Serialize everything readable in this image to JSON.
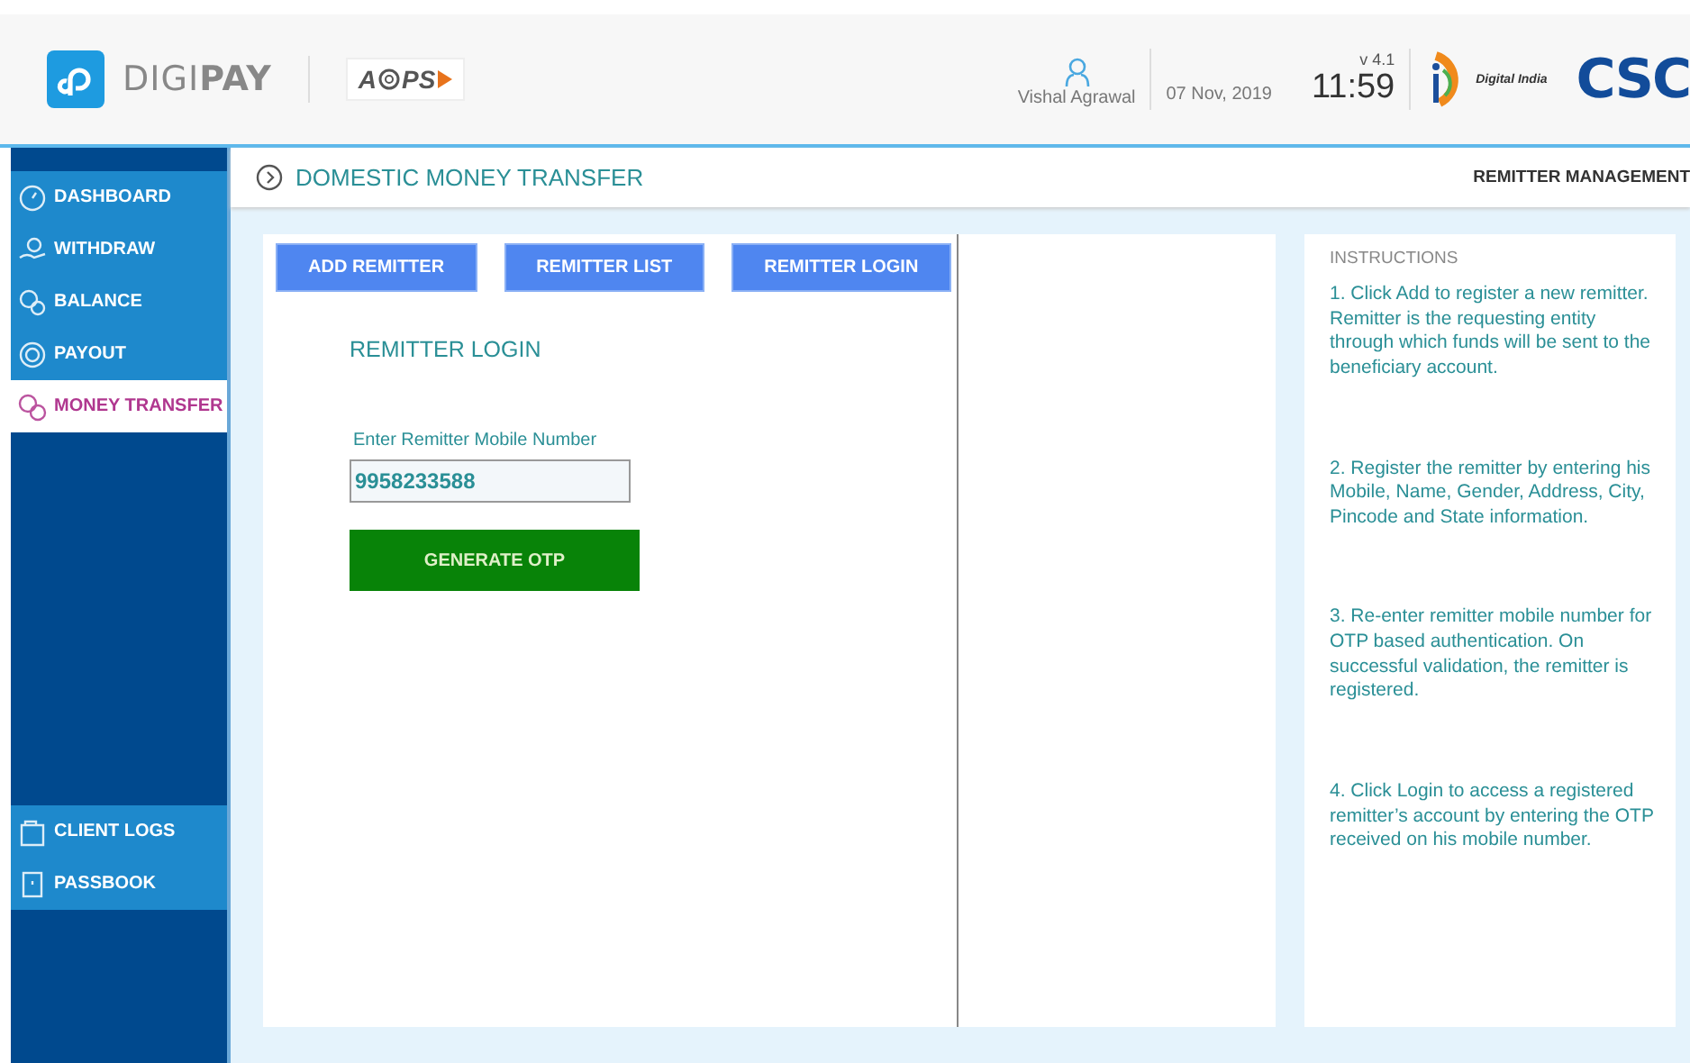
{
  "header": {
    "brand": "DIGI**PAY**",
    "aeps_logo": {
      "left": "A",
      "right": "PS"
    },
    "user_name": "Vishal Agrawal",
    "date": "07 Nov, 2019",
    "version": "v 4.1",
    "time": "11:59",
    "digital_india": "Digital India",
    "csc": "CSC"
  },
  "sidebar": {
    "items": [
      {
        "label": "DASHBOARD",
        "selected": false
      },
      {
        "label": "WITHDRAW",
        "selected": false
      },
      {
        "label": "BALANCE",
        "selected": false
      },
      {
        "label": "PAYOUT",
        "selected": false
      },
      {
        "label": "MONEY TRANSFER",
        "selected": true
      }
    ],
    "bottom_items": [
      {
        "label": "CLIENT LOGS"
      },
      {
        "label": "PASSBOOK"
      }
    ]
  },
  "page": {
    "title": "DOMESTIC MONEY TRANSFER",
    "right_title": "REMITTER MANAGEMENT"
  },
  "actions": [
    "ADD REMITTER",
    "REMITTER LIST",
    "REMITTER LOGIN"
  ],
  "form": {
    "heading": "REMITTER LOGIN",
    "field_label": "Enter Remitter Mobile Number",
    "field_value": "9958233588",
    "submit": "GENERATE OTP"
  },
  "instructions": {
    "heading": "INSTRUCTIONS",
    "steps": [
      "1. Click Add to register a new remitter. Remitter is the requesting entity through which funds will be sent to the beneficiary account.",
      "2. Register the remitter by entering his Mobile, Name, Gender, Address, City, Pincode and State information.",
      "3. Re-enter remitter mobile number for OTP based authentication. On successful validation, the remitter is registered.",
      "4. Click Login to access a registered remitter’s account by entering the OTP received on his mobile number."
    ]
  }
}
